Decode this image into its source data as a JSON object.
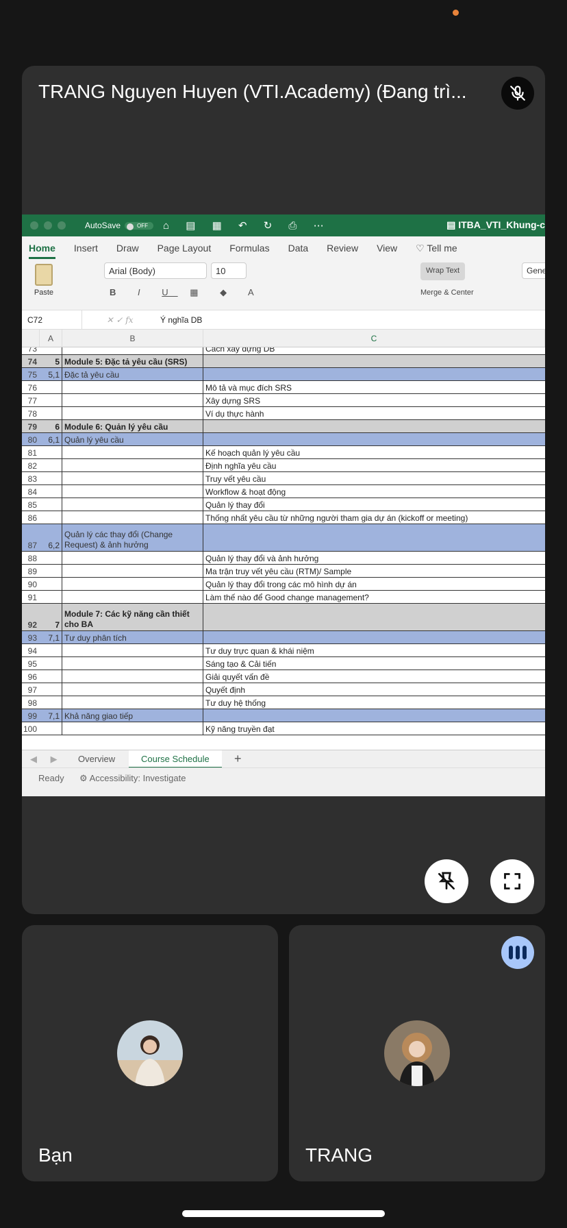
{
  "main": {
    "presenter_name": "TRANG Nguyen Huyen (VTI.Academy) (Đang trì..."
  },
  "excel": {
    "autosave_label": "AutoSave",
    "autosave_state": "OFF",
    "file_title": "ITBA_VTI_Khung-c",
    "tabs": [
      "Home",
      "Insert",
      "Draw",
      "Page Layout",
      "Formulas",
      "Data",
      "Review",
      "View",
      "Tell me"
    ],
    "paste_label": "Paste",
    "font_name": "Arial (Body)",
    "font_size": "10",
    "wrap_text": "Wrap Text",
    "merge_center": "Merge & Center",
    "number_format": "Gene",
    "name_box": "C72",
    "formula": "Ý nghĩa DB",
    "columns": [
      "A",
      "B",
      "C"
    ],
    "rows": [
      {
        "n": "73",
        "a": "",
        "b": "",
        "c": "Cách xây dựng DB",
        "type": "normal"
      },
      {
        "n": "74",
        "a": "5",
        "b": "Module 5: Đặc tả yêu cầu (SRS)",
        "c": "",
        "type": "module"
      },
      {
        "n": "75",
        "a": "5,1",
        "b": "Đặc tả yêu cầu",
        "c": "",
        "type": "section"
      },
      {
        "n": "76",
        "a": "",
        "b": "",
        "c": "Mô tả và mục đích SRS",
        "type": "normal"
      },
      {
        "n": "77",
        "a": "",
        "b": "",
        "c": "Xây dựng SRS",
        "type": "normal"
      },
      {
        "n": "78",
        "a": "",
        "b": "",
        "c": "Ví dụ thực hành",
        "type": "normal"
      },
      {
        "n": "79",
        "a": "6",
        "b": "Module 6: Quản lý yêu cầu",
        "c": "",
        "type": "module"
      },
      {
        "n": "80",
        "a": "6,1",
        "b": "Quản lý yêu cầu",
        "c": "",
        "type": "section"
      },
      {
        "n": "81",
        "a": "",
        "b": "",
        "c": "Kế hoạch quản lý yêu cầu",
        "type": "normal"
      },
      {
        "n": "82",
        "a": "",
        "b": "",
        "c": "Định nghĩa yêu cầu",
        "type": "normal"
      },
      {
        "n": "83",
        "a": "",
        "b": "",
        "c": "Truy vết yêu cầu",
        "type": "normal"
      },
      {
        "n": "84",
        "a": "",
        "b": "",
        "c": "Workflow & hoạt động",
        "type": "normal"
      },
      {
        "n": "85",
        "a": "",
        "b": "",
        "c": "Quản lý thay đổi",
        "type": "normal"
      },
      {
        "n": "86",
        "a": "",
        "b": "",
        "c": "Thống nhất yêu cầu từ những người tham gia dự án (kickoff or meeting)",
        "type": "normal"
      },
      {
        "n": "87",
        "a": "6,2",
        "b": "Quản lý các thay đổi (Change Request) & ảnh hưởng",
        "c": "",
        "type": "section tall"
      },
      {
        "n": "88",
        "a": "",
        "b": "",
        "c": "Quản lý thay đổi và ảnh hưởng",
        "type": "normal"
      },
      {
        "n": "89",
        "a": "",
        "b": "",
        "c": "Ma trận truy vết yêu cầu (RTM)/ Sample",
        "type": "normal"
      },
      {
        "n": "90",
        "a": "",
        "b": "",
        "c": "Quản lý thay đổi trong các mô hình dự án",
        "type": "normal"
      },
      {
        "n": "91",
        "a": "",
        "b": "",
        "c": "Làm thế nào để Good change management?",
        "type": "normal"
      },
      {
        "n": "92",
        "a": "7",
        "b": "Module 7: Các kỹ năng cần thiết cho BA",
        "c": "",
        "type": "module tall"
      },
      {
        "n": "93",
        "a": "7,1",
        "b": "Tư duy phân tích",
        "c": "",
        "type": "section"
      },
      {
        "n": "94",
        "a": "",
        "b": "",
        "c": "Tư duy trực quan & khái niệm",
        "type": "normal"
      },
      {
        "n": "95",
        "a": "",
        "b": "",
        "c": "Sáng tạo & Cải tiến",
        "type": "normal"
      },
      {
        "n": "96",
        "a": "",
        "b": "",
        "c": "Giải quyết vấn đề",
        "type": "normal"
      },
      {
        "n": "97",
        "a": "",
        "b": "",
        "c": "Quyết định",
        "type": "normal"
      },
      {
        "n": "98",
        "a": "",
        "b": "",
        "c": "Tư duy hệ thống",
        "type": "normal"
      },
      {
        "n": "99",
        "a": "7,1",
        "b": "Khả năng giao tiếp",
        "c": "",
        "type": "section"
      },
      {
        "n": "100",
        "a": "",
        "b": "",
        "c": "Kỹ năng truyền đạt",
        "type": "normal"
      }
    ],
    "sheet_tabs": [
      "Overview",
      "Course Schedule"
    ],
    "status_ready": "Ready",
    "status_accessibility": "Accessibility: Investigate"
  },
  "participants": {
    "you_name": "Bạn",
    "trang_name": "TRANG"
  },
  "colors": {
    "excel_green": "#1e7145",
    "section_blue": "#9fb3dd",
    "speaking_indicator": "#a8c7fa"
  }
}
